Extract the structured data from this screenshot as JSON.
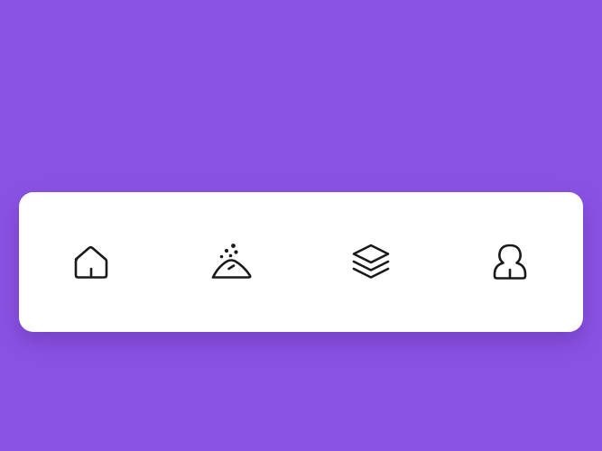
{
  "colors": {
    "background": "#8a52e3",
    "tab_bar": "#ffffff",
    "icon": "#1a1a1a"
  },
  "tab_bar": {
    "items": [
      {
        "icon": "house-icon"
      },
      {
        "icon": "sand-pile-icon"
      },
      {
        "icon": "layers-icon"
      },
      {
        "icon": "user-icon"
      }
    ]
  }
}
